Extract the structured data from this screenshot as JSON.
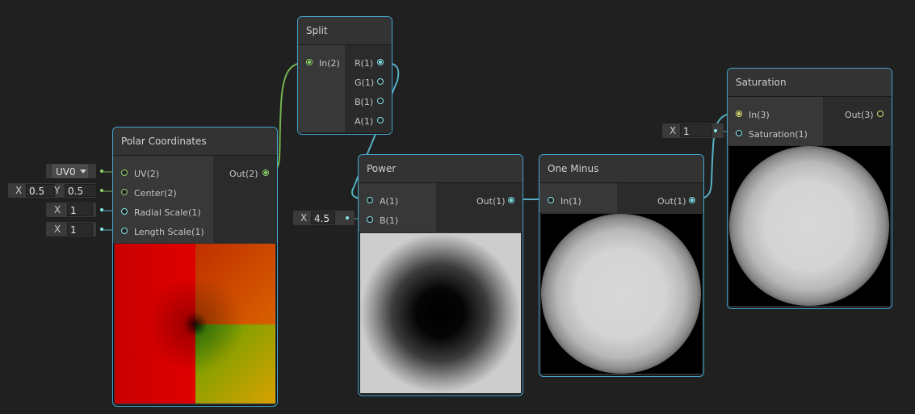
{
  "nodes": {
    "split": {
      "title": "Split",
      "input": "In(2)",
      "outputs": [
        "R(1)",
        "G(1)",
        "B(1)",
        "A(1)"
      ]
    },
    "polar": {
      "title": "Polar Coordinates",
      "inputs": [
        "UV(2)",
        "Center(2)",
        "Radial Scale(1)",
        "Length Scale(1)"
      ],
      "output": "Out(2)"
    },
    "power": {
      "title": "Power",
      "inputs": [
        "A(1)",
        "B(1)"
      ],
      "output": "Out(1)"
    },
    "one_minus": {
      "title": "One Minus",
      "input": "In(1)",
      "output": "Out(1)"
    },
    "saturation": {
      "title": "Saturation",
      "inputs": [
        "In(3)",
        "Saturation(1)"
      ],
      "output": "Out(3)"
    }
  },
  "fields": {
    "uv_dropdown": "UV0",
    "center_x_label": "X",
    "center_x": "0.5",
    "center_y_label": "Y",
    "center_y": "0.5",
    "radial_x_label": "X",
    "radial_scale": "1",
    "length_x_label": "X",
    "length_scale": "1",
    "power_b_label": "X",
    "power_b": "4.5",
    "saturation_label": "X",
    "saturation": "1"
  },
  "icons": {
    "dropdown": "dropdown-arrow-icon"
  },
  "colors": {
    "node_border": "#44a5cf",
    "vector2_port": "#8fd26b",
    "float_port": "#84e4e7",
    "vector3_port": "#e3e37a",
    "canvas": "#202020"
  }
}
